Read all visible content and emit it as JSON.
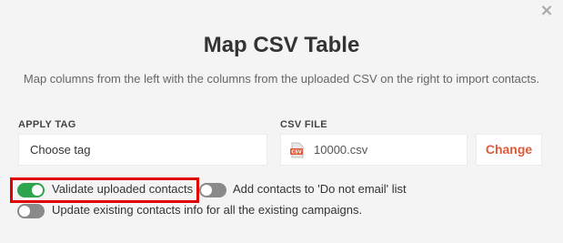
{
  "dialog": {
    "title": "Map CSV Table",
    "subtitle": "Map columns from the left with the columns from the uploaded CSV on the right to import contacts.",
    "close_icon": "close-icon"
  },
  "apply_tag": {
    "label": "APPLY TAG",
    "value": "Choose tag"
  },
  "csv_file": {
    "label": "CSV FILE",
    "file_name": "10000.csv",
    "icon": "csv-file-icon",
    "change_label": "Change"
  },
  "options": {
    "validate": {
      "label": "Validate uploaded contacts",
      "checked": true
    },
    "do_not_email": {
      "label": "Add contacts to 'Do not email' list",
      "checked": false
    },
    "update_existing": {
      "label": "Update existing contacts info for all the existing campaigns.",
      "checked": false
    }
  },
  "colors": {
    "accent": "#e05a3a",
    "toggle_on": "#2ea44f",
    "toggle_off": "#8a8a8a",
    "highlight": "#e00000"
  }
}
